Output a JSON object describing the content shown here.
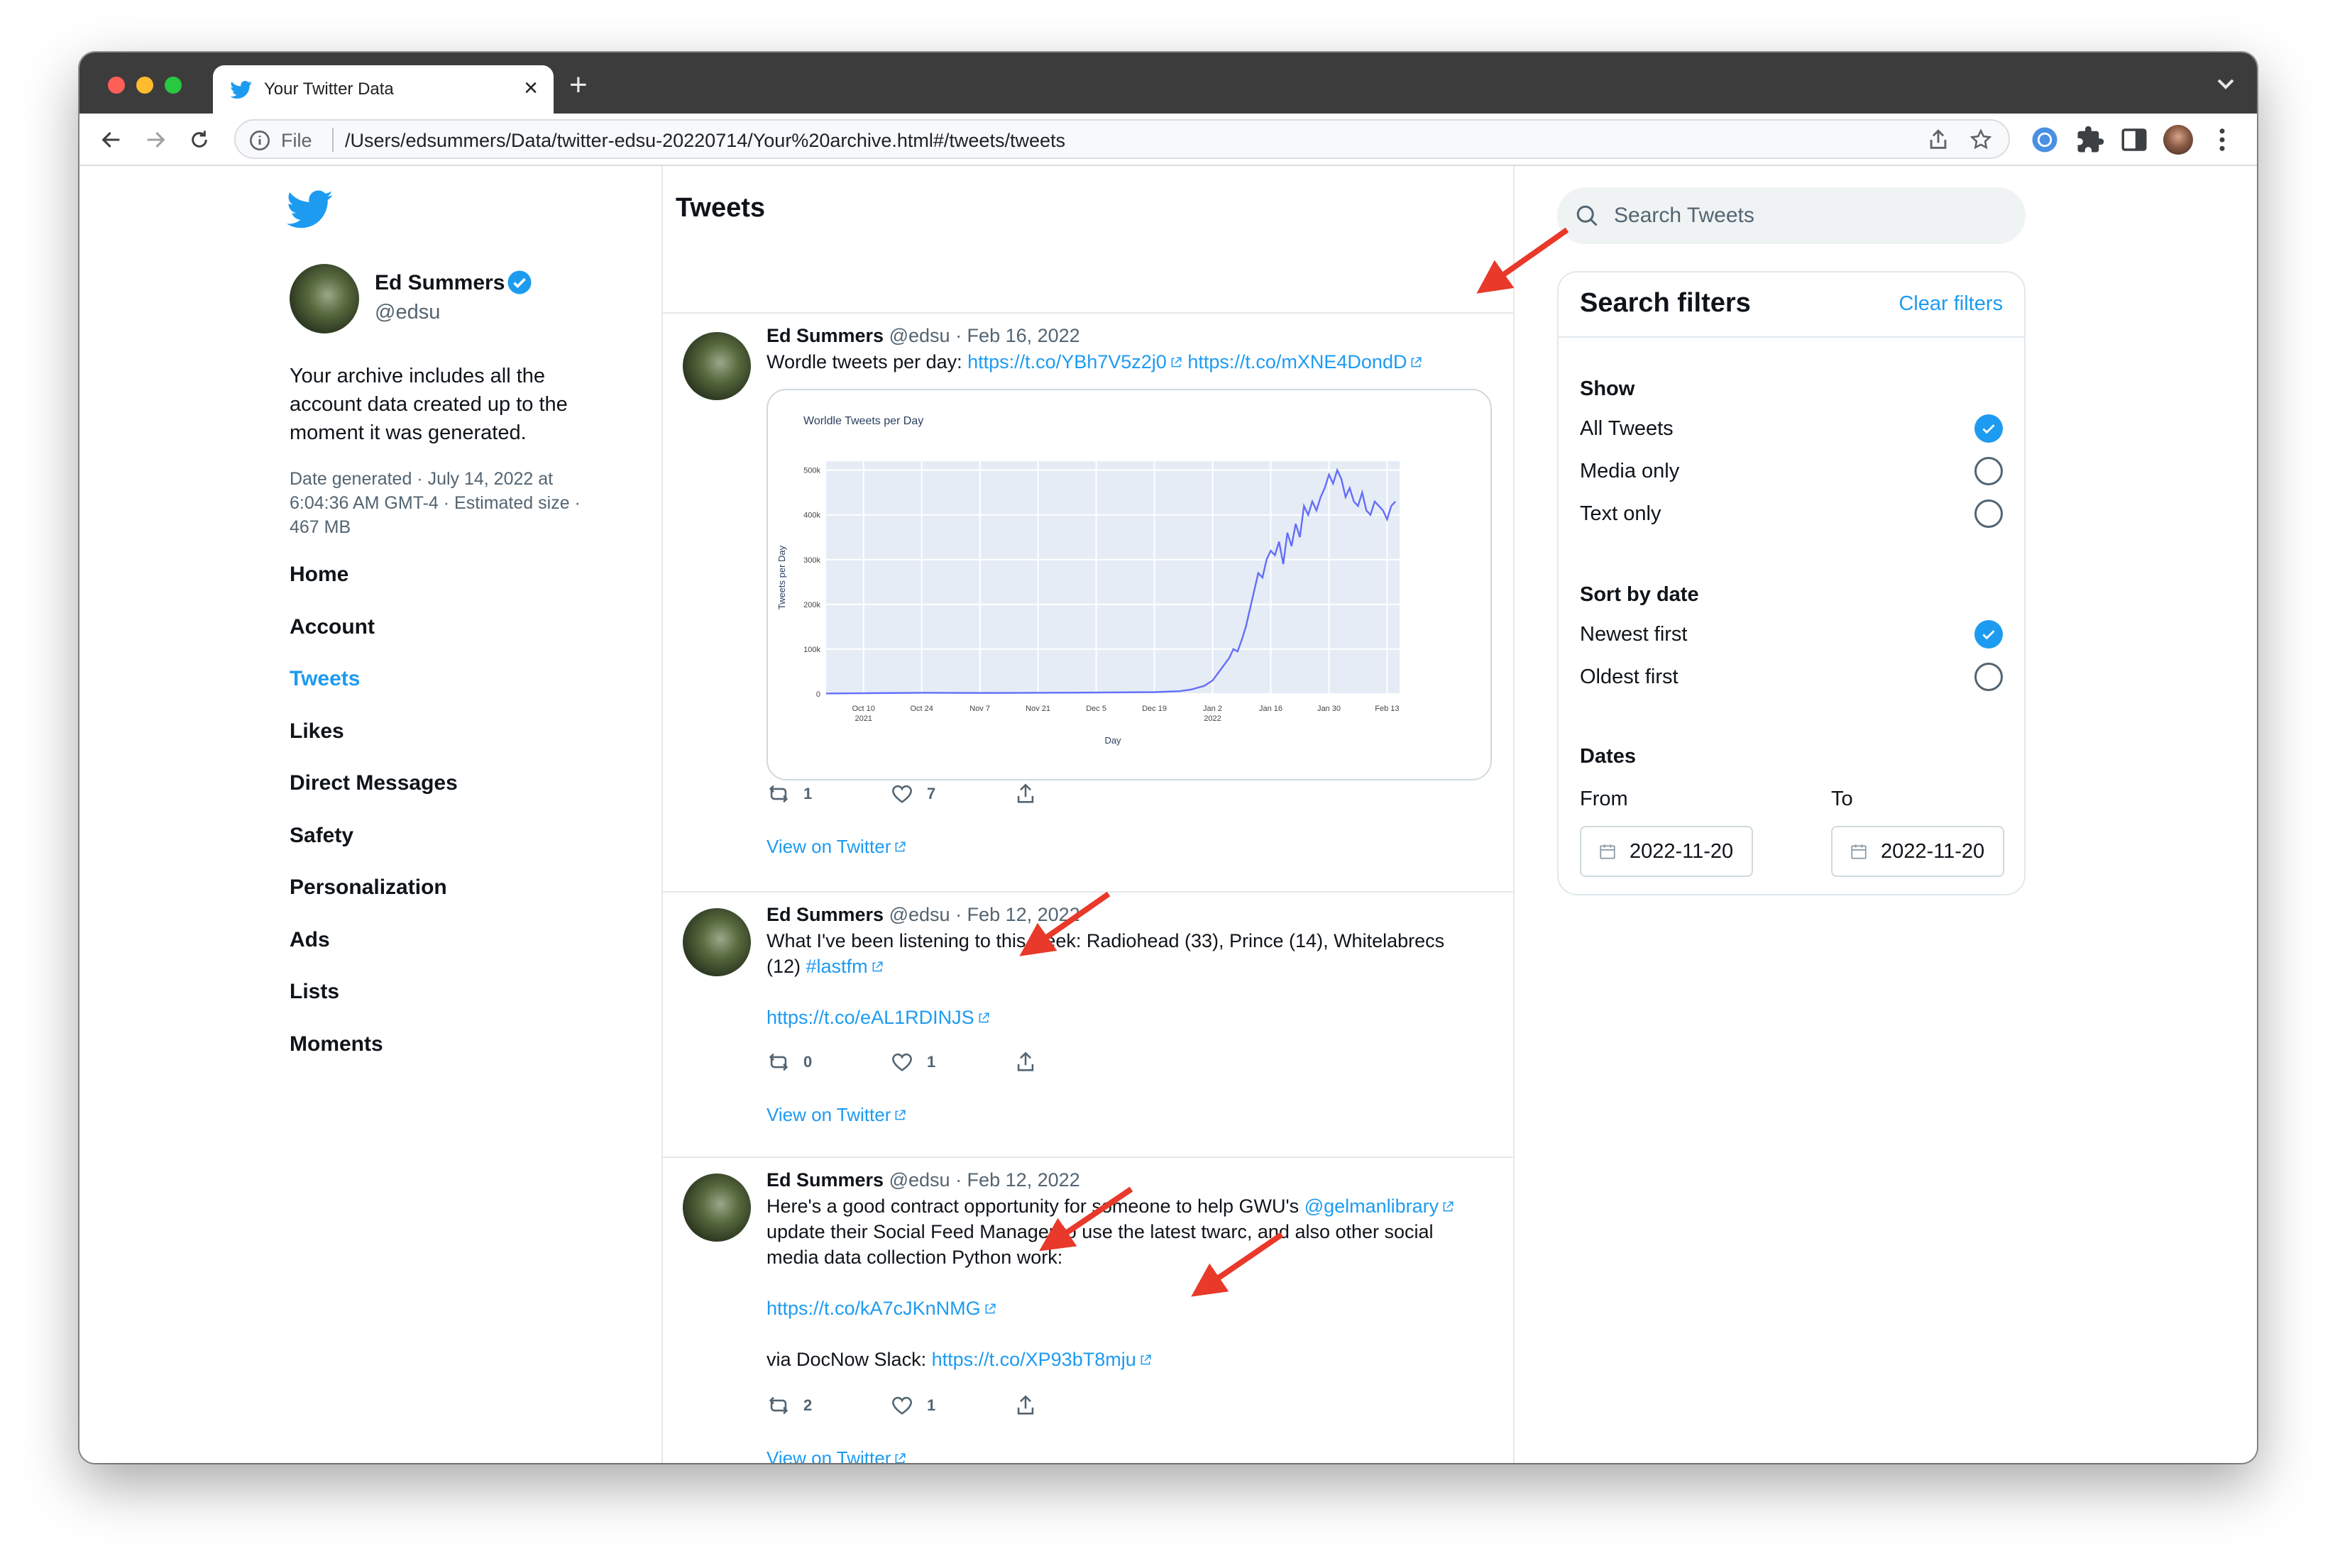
{
  "browser": {
    "tab_title": "Your Twitter Data",
    "tab_close": "×",
    "new_tab": "+",
    "scheme": "File",
    "url": "/Users/edsummers/Data/twitter-edsu-20220714/Your%20archive.html#/tweets/tweets"
  },
  "profile": {
    "name": "Ed Summers",
    "handle": "@edsu",
    "archive_note": "Your archive includes all the account data created up to the moment it was generated.",
    "archive_meta": "Date generated · July 14, 2022 at 6:04:36 AM GMT-4 · Estimated size · 467 MB"
  },
  "nav": [
    {
      "label": "Home",
      "active": false
    },
    {
      "label": "Account",
      "active": false
    },
    {
      "label": "Tweets",
      "active": true
    },
    {
      "label": "Likes",
      "active": false
    },
    {
      "label": "Direct Messages",
      "active": false
    },
    {
      "label": "Safety",
      "active": false
    },
    {
      "label": "Personalization",
      "active": false
    },
    {
      "label": "Ads",
      "active": false
    },
    {
      "label": "Lists",
      "active": false
    },
    {
      "label": "Moments",
      "active": false
    }
  ],
  "tweets_header": "Tweets",
  "tweets": [
    {
      "name": "Ed Summers",
      "handle": "@edsu",
      "date": "· Feb 16, 2022",
      "text": "Wordle tweets per day: ",
      "link1": "https://t.co/YBh7V5z2j0",
      "link2": "https://t.co/mXNE4DondD",
      "retweets": "1",
      "likes": "7",
      "view_on": "View on Twitter"
    },
    {
      "name": "Ed Summers",
      "handle": "@edsu",
      "date": "· Feb 12, 2022",
      "text": "What I've been listening to this week: Radiohead (33), Prince (14), Whitelabrecs (12) ",
      "hashtag": "#lastfm",
      "link1": "https://t.co/eAL1RDINJS",
      "retweets": "0",
      "likes": "1",
      "view_on": "View on Twitter"
    },
    {
      "name": "Ed Summers",
      "handle": "@edsu",
      "date": "· Feb 12, 2022",
      "text": "Here's a good contract opportunity for someone to help GWU's ",
      "mention": "@gelmanlibrary",
      "text_after": " update their Social Feed Manager to use the latest twarc, and also other social media data collection Python work:",
      "link1": "https://t.co/kA7cJKnNMG",
      "via_text": "via DocNow Slack: ",
      "link2": "https://t.co/XP93bT8mju",
      "retweets": "2",
      "likes": "1",
      "view_on": "View on Twitter"
    }
  ],
  "search": {
    "placeholder": "Search Tweets"
  },
  "filters": {
    "title": "Search filters",
    "clear": "Clear filters",
    "show_label": "Show",
    "show_options": [
      {
        "label": "All Tweets",
        "checked": true
      },
      {
        "label": "Media only",
        "checked": false
      },
      {
        "label": "Text only",
        "checked": false
      }
    ],
    "sort_label": "Sort by date",
    "sort_options": [
      {
        "label": "Newest first",
        "checked": true
      },
      {
        "label": "Oldest first",
        "checked": false
      }
    ],
    "dates_label": "Dates",
    "from_label": "From",
    "to_label": "To",
    "from_value": "2022-11-20",
    "to_value": "2022-11-20"
  },
  "colors": {
    "accent": "#1d9bf0",
    "arrow": "#e8392a",
    "chart_line": "#636efa",
    "chart_bg": "#e5ecf6"
  },
  "chart_data": {
    "type": "line",
    "title": "Worldle Tweets per Day",
    "xlabel": "Day",
    "ylabel": "Tweets per Day",
    "x_tick_labels": [
      "Oct 10\n2021",
      "Oct 24",
      "Nov 7",
      "Nov 21",
      "Dec 5",
      "Dec 19",
      "Jan 2\n2022",
      "Jan 16",
      "Jan 30",
      "Feb 13"
    ],
    "y_tick_labels": [
      "0",
      "100k",
      "200k",
      "300k",
      "400k",
      "500k"
    ],
    "ylim": [
      0,
      520000
    ],
    "x_days_from": "2021-10-01",
    "x": [
      "2021-10-01",
      "2021-10-10",
      "2021-10-24",
      "2021-11-07",
      "2021-11-21",
      "2021-12-05",
      "2021-12-19",
      "2021-12-25",
      "2021-12-28",
      "2021-12-31",
      "2022-01-02",
      "2022-01-04",
      "2022-01-06",
      "2022-01-07",
      "2022-01-08",
      "2022-01-09",
      "2022-01-10",
      "2022-01-11",
      "2022-01-12",
      "2022-01-13",
      "2022-01-14",
      "2022-01-15",
      "2022-01-16",
      "2022-01-17",
      "2022-01-18",
      "2022-01-19",
      "2022-01-20",
      "2022-01-21",
      "2022-01-22",
      "2022-01-23",
      "2022-01-24",
      "2022-01-25",
      "2022-01-26",
      "2022-01-27",
      "2022-01-28",
      "2022-01-29",
      "2022-01-30",
      "2022-01-31",
      "2022-02-01",
      "2022-02-02",
      "2022-02-03",
      "2022-02-04",
      "2022-02-05",
      "2022-02-06",
      "2022-02-07",
      "2022-02-08",
      "2022-02-09",
      "2022-02-10",
      "2022-02-11",
      "2022-02-12",
      "2022-02-13",
      "2022-02-14",
      "2022-02-15"
    ],
    "y": [
      1000,
      1500,
      2500,
      2000,
      2500,
      3000,
      4000,
      6000,
      10000,
      18000,
      30000,
      55000,
      80000,
      100000,
      95000,
      120000,
      150000,
      190000,
      230000,
      270000,
      260000,
      300000,
      320000,
      310000,
      340000,
      290000,
      360000,
      330000,
      380000,
      350000,
      420000,
      400000,
      430000,
      410000,
      440000,
      460000,
      490000,
      470000,
      500000,
      480000,
      440000,
      460000,
      430000,
      420000,
      450000,
      410000,
      400000,
      430000,
      420000,
      410000,
      390000,
      420000,
      430000
    ]
  }
}
